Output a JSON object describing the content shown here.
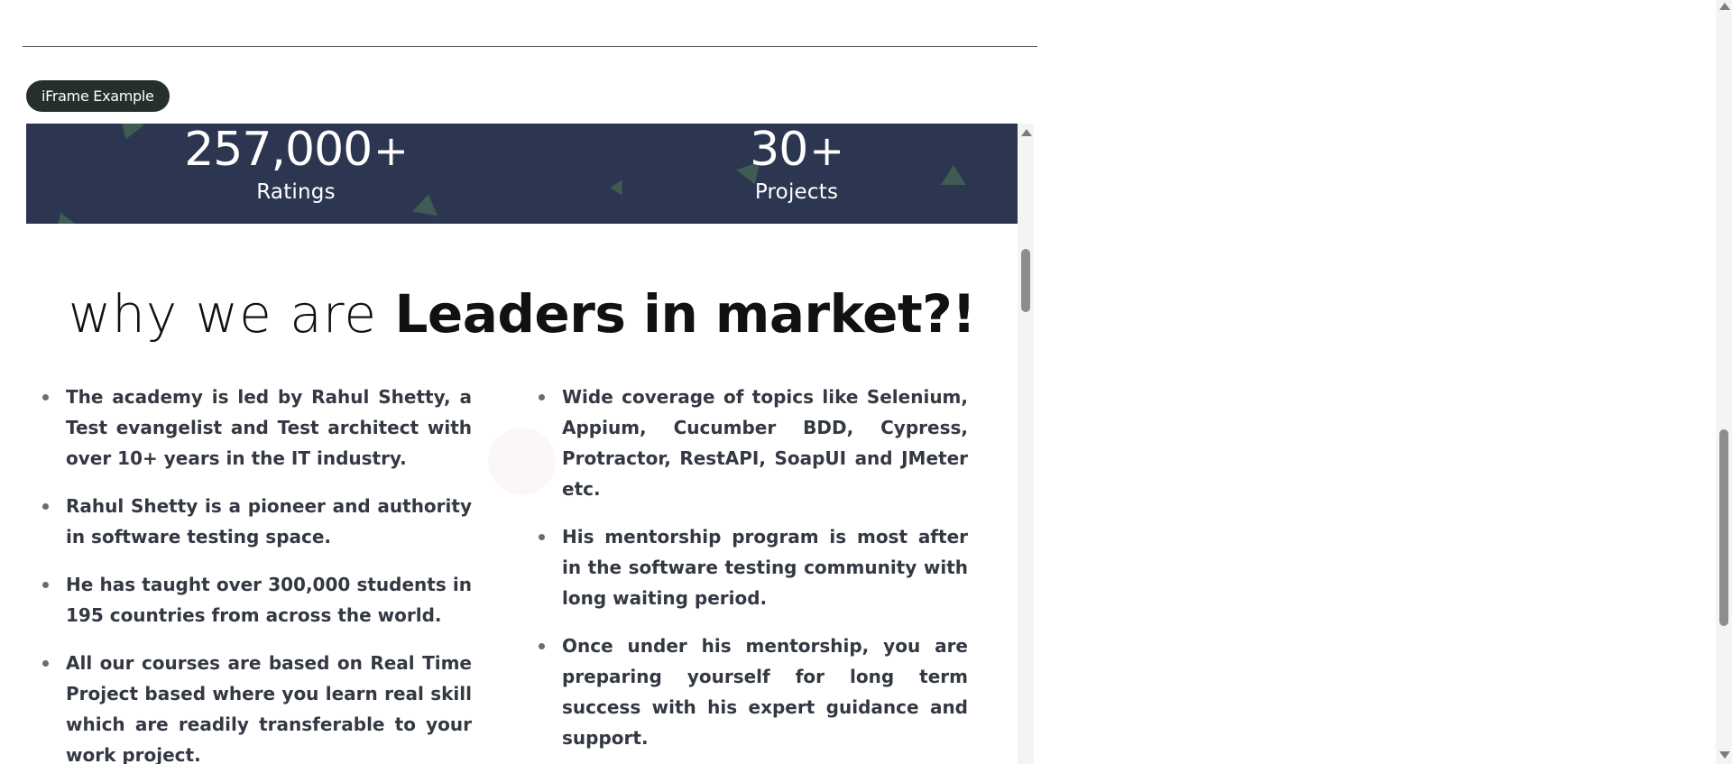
{
  "badge": {
    "label": "iFrame Example"
  },
  "stats": [
    {
      "value": "257,000",
      "suffix": "+",
      "label": "Ratings"
    },
    {
      "value": "30",
      "suffix": "+",
      "label": "Projects"
    }
  ],
  "headline": {
    "light": "why we are ",
    "bold": "Leaders in market?!"
  },
  "left_points": [
    "The academy is led by Rahul Shetty, a Test evangelist and Test architect with over 10+ years in the IT industry.",
    "Rahul Shetty is a pioneer and authority in software testing space.",
    "He has taught over 300,000 students in 195 countries from across the world.",
    "All our courses are based on Real Time Project based where you learn real skill which are readily transferable to your work project."
  ],
  "right_points": [
    "Wide coverage of topics like Selenium, Appium, Cucumber BDD, Cypress, Protractor, RestAPI, SoapUI and JMeter etc.",
    "His mentorship program is most after in the software testing community with long waiting period.",
    "Once under his mentorship, you are preparing yourself for long term success with his expert guidance and support."
  ],
  "colors": {
    "badge_bg": "#25302c",
    "stats_band_bg": "#2d3651",
    "body_text": "#333842",
    "triangle": "#3e5b54"
  }
}
